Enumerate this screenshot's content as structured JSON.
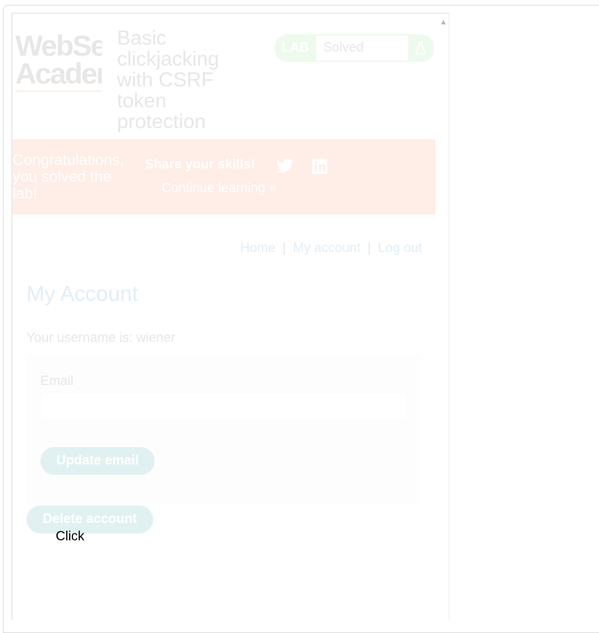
{
  "lab": {
    "logo_line1": "WebSecurity",
    "logo_line2": "Academy",
    "title": "Basic clickjacking with CSRF token protection",
    "status_tag": "LAB",
    "status_value": "Solved"
  },
  "banner": {
    "congrats": "Congratulations, you solved the lab!",
    "share": "Share your skills!",
    "continue": "Continue learning",
    "twitter_icon": "twitter-icon",
    "linkedin_icon": "linkedin-icon"
  },
  "nav": {
    "home": "Home",
    "my_account": "My account",
    "logout": "Log out",
    "separator": "|"
  },
  "account": {
    "title": "My Account",
    "username_line": "Your username is: wiener",
    "email_label": "Email",
    "email_value": "",
    "update_button": "Update email",
    "delete_button": "Delete account"
  },
  "decoy": {
    "label": "Click"
  },
  "colors": {
    "brand_orange": "#ff6633",
    "solved_green": "#70d16d",
    "link_blue": "#0071bc",
    "button_teal": "#008b8b"
  }
}
